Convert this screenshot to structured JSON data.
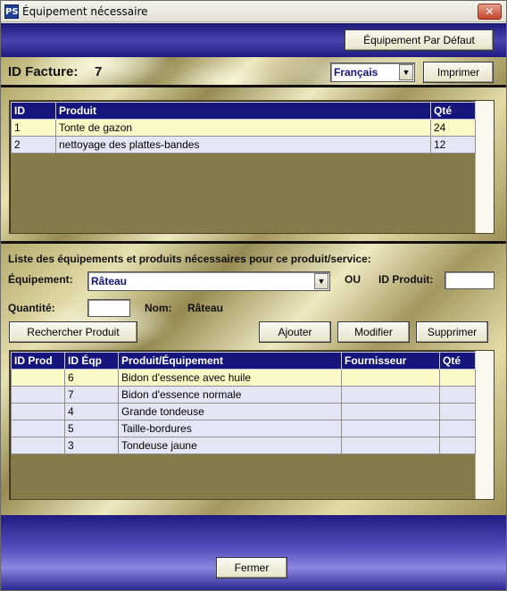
{
  "window": {
    "title": "Équipement nécessaire",
    "icon": "ps-app-icon",
    "close_label": "✕"
  },
  "header": {
    "default_button": "Équipement Par Défaut"
  },
  "invoice": {
    "id_label": "ID Facture:",
    "id_value": "7",
    "language_value": "Français",
    "print_button": "Imprimer"
  },
  "products_table": {
    "columns": [
      "ID",
      "Produit",
      "Qté"
    ],
    "rows": [
      {
        "id": "1",
        "product": "Tonte de gazon",
        "qty": "24"
      },
      {
        "id": "2",
        "product": "nettoyage des plattes-bandes",
        "qty": "12"
      }
    ]
  },
  "equipment_form": {
    "heading": "Liste des équipements et produits nécessaires pour ce produit/service:",
    "equipment_label": "Équipement:",
    "equipment_value": "Râteau",
    "or_label": "OU",
    "product_id_label": "ID Produit:",
    "product_id_value": "",
    "quantity_label": "Quantité:",
    "quantity_value": "",
    "name_label": "Nom:",
    "name_value": "Râteau",
    "search_button": "Rechercher Produit",
    "add_button": "Ajouter",
    "edit_button": "Modifier",
    "delete_button": "Supprimer"
  },
  "equipment_table": {
    "columns": [
      "ID Prod",
      "ID Éqp",
      "Produit/Équipement",
      "Fournisseur",
      "Qté"
    ],
    "rows": [
      {
        "id_prod": "",
        "id_eqp": "6",
        "name": "Bidon d'essence avec huile",
        "supplier": "",
        "qty": ""
      },
      {
        "id_prod": "",
        "id_eqp": "7",
        "name": "Bidon d'essence normale",
        "supplier": "",
        "qty": ""
      },
      {
        "id_prod": "",
        "id_eqp": "4",
        "name": "Grande tondeuse",
        "supplier": "",
        "qty": ""
      },
      {
        "id_prod": "",
        "id_eqp": "5",
        "name": "Taille-bordures",
        "supplier": "",
        "qty": ""
      },
      {
        "id_prod": "",
        "id_eqp": "3",
        "name": "Tondeuse jaune",
        "supplier": "",
        "qty": ""
      }
    ]
  },
  "footer": {
    "close_button": "Fermer"
  },
  "colors": {
    "header_band": "#1b1a78",
    "table_header": "#17167c",
    "row_selected": "#fbf9c6",
    "row_normal": "#e5e6f5",
    "panel": "#857b4a"
  }
}
